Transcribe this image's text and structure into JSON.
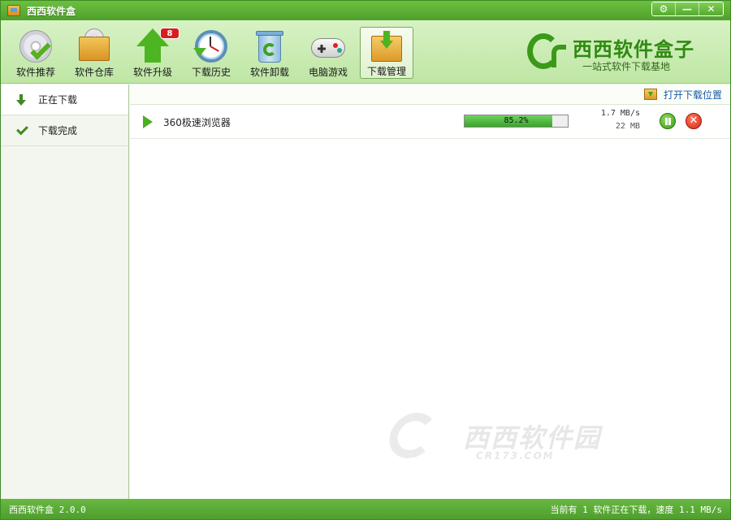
{
  "window": {
    "title": "西西软件盒",
    "controls": [
      "⚙",
      "—",
      "✕"
    ]
  },
  "toolbar": {
    "items": [
      {
        "label": "软件推荐",
        "icon": "disc-check-icon"
      },
      {
        "label": "软件仓库",
        "icon": "box-disc-icon"
      },
      {
        "label": "软件升级",
        "icon": "upgrade-arrow-icon",
        "badge": "8"
      },
      {
        "label": "下载历史",
        "icon": "clock-history-icon"
      },
      {
        "label": "软件卸载",
        "icon": "recycle-bin-icon"
      },
      {
        "label": "电脑游戏",
        "icon": "gamepad-icon"
      },
      {
        "label": "下载管理",
        "icon": "download-folder-icon",
        "active": true
      }
    ]
  },
  "brand": {
    "name": "西西软件盒子",
    "slogan": "一站式软件下载基地"
  },
  "sidebar": {
    "items": [
      {
        "label": "正在下载",
        "icon": "down-arrow-icon",
        "active": true
      },
      {
        "label": "下载完成",
        "icon": "check-icon"
      }
    ]
  },
  "main": {
    "open_location": "打开下载位置",
    "downloads": [
      {
        "name": "360极速浏览器",
        "progress": 0.852,
        "progress_text": "85.2%",
        "speed": "1.7 MB/s",
        "size": "22 MB"
      }
    ],
    "cancel_glyph": "✕"
  },
  "watermark": {
    "text": "西西软件园",
    "sub": "CR173.COM"
  },
  "statusbar": {
    "version": "西西软件盒 2.0.0",
    "status": "当前有 1 软件正在下载，速度 1.1 MB/s"
  },
  "colors": {
    "accent": "#4fa02c",
    "link": "#1a5aa8",
    "cancel": "#d0281a"
  }
}
